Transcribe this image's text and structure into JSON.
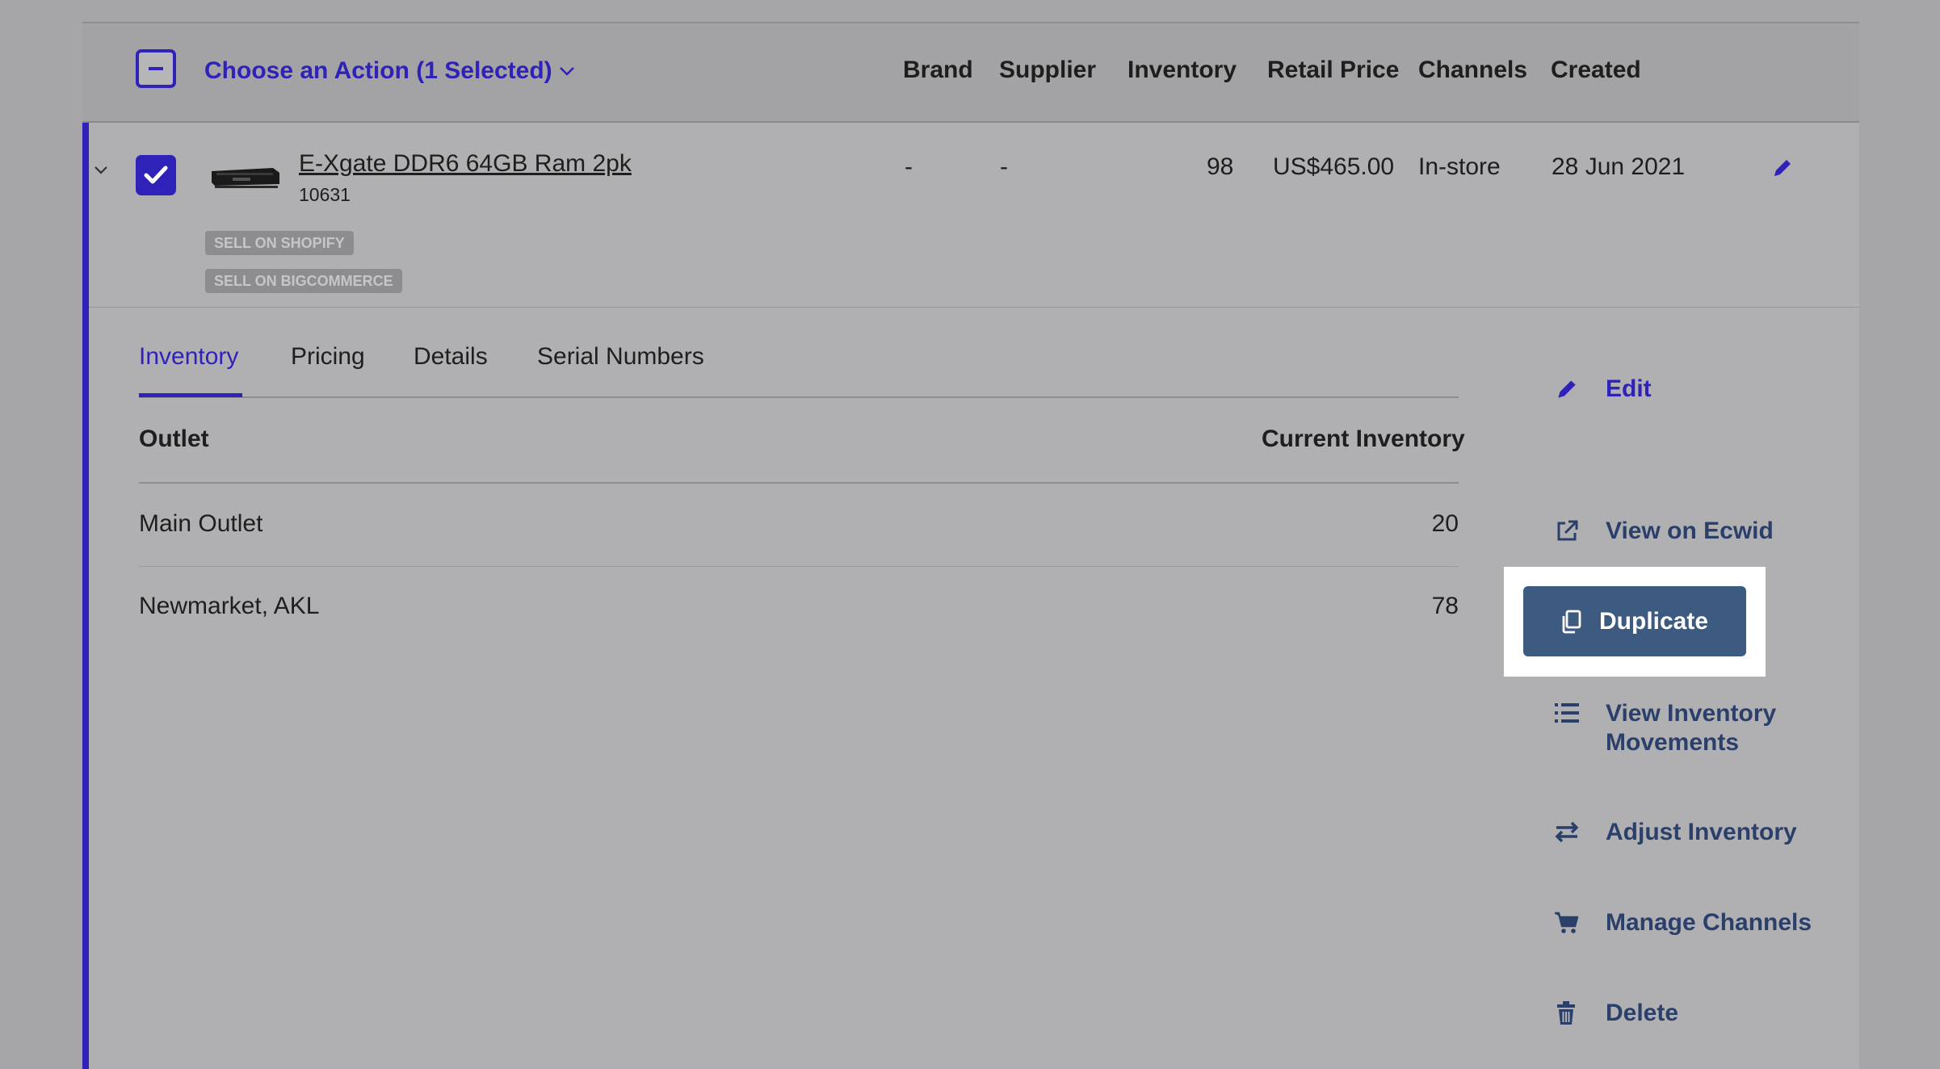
{
  "header": {
    "action_menu_label": "Choose an Action (1 Selected)",
    "columns": {
      "brand": "Brand",
      "supplier": "Supplier",
      "inventory": "Inventory",
      "retail_price": "Retail Price",
      "channels": "Channels",
      "created": "Created"
    }
  },
  "product": {
    "name": "E-Xgate DDR6 64GB Ram 2pk",
    "sku": "10631",
    "tags": [
      "SELL ON SHOPIFY",
      "SELL ON BIGCOMMERCE"
    ],
    "brand": "-",
    "supplier": "-",
    "inventory": "98",
    "retail_price": "US$465.00",
    "channels": "In-store",
    "created": "28 Jun 2021"
  },
  "tabs": [
    "Inventory",
    "Pricing",
    "Details",
    "Serial Numbers"
  ],
  "inventory_table": {
    "headers": {
      "outlet": "Outlet",
      "current": "Current Inventory"
    },
    "rows": [
      {
        "outlet": "Main Outlet",
        "current": "20"
      },
      {
        "outlet": "Newmarket, AKL",
        "current": "78"
      }
    ]
  },
  "actions": {
    "edit": "Edit",
    "view_on_ecwid": "View on Ecwid",
    "duplicate": "Duplicate",
    "view_inventory_movements_line1": "View Inventory",
    "view_inventory_movements_line2": "Movements",
    "adjust_inventory": "Adjust Inventory",
    "manage_channels": "Manage Channels",
    "delete": "Delete"
  },
  "colors": {
    "accent": "#2e22b8",
    "action_text": "#2b3f6b",
    "duplicate_button": "#3d5a80",
    "overlay_background": "#a6a6a8"
  }
}
